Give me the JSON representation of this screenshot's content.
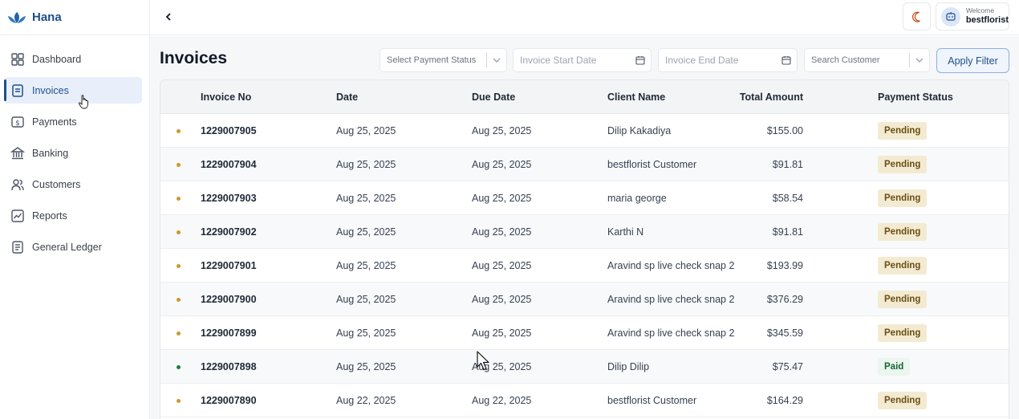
{
  "brand": {
    "name": "Hana",
    "color": "#1e4e8c"
  },
  "sidebar": {
    "items": [
      {
        "label": "Dashboard",
        "icon": "dashboard-grid-icon",
        "active": false
      },
      {
        "label": "Invoices",
        "icon": "invoice-icon",
        "active": true
      },
      {
        "label": "Payments",
        "icon": "dollar-icon",
        "active": false
      },
      {
        "label": "Banking",
        "icon": "bank-icon",
        "active": false
      },
      {
        "label": "Customers",
        "icon": "users-icon",
        "active": false
      },
      {
        "label": "Reports",
        "icon": "chart-line-icon",
        "active": false
      },
      {
        "label": "General Ledger",
        "icon": "ledger-icon",
        "active": false
      }
    ]
  },
  "topbar": {
    "welcome": "Welcome",
    "username": "bestflorist"
  },
  "page": {
    "title": "Invoices"
  },
  "filters": {
    "payment_status_placeholder": "Select Payment Status",
    "start_date_placeholder": "Invoice Start Date",
    "end_date_placeholder": "Invoice End Date",
    "customer_placeholder": "Search Customer",
    "apply_label": "Apply Filter"
  },
  "table": {
    "columns": [
      "Invoice No",
      "Date",
      "Due Date",
      "Client Name",
      "Total Amount",
      "Payment Status"
    ],
    "rows": [
      {
        "invoice_no": "1229007905",
        "date": "Aug 25, 2025",
        "due_date": "Aug 25, 2025",
        "client": "Dilip Kakadiya",
        "amount": "$155.00",
        "status": "Pending"
      },
      {
        "invoice_no": "1229007904",
        "date": "Aug 25, 2025",
        "due_date": "Aug 25, 2025",
        "client": "bestflorist Customer",
        "amount": "$91.81",
        "status": "Pending"
      },
      {
        "invoice_no": "1229007903",
        "date": "Aug 25, 2025",
        "due_date": "Aug 25, 2025",
        "client": "maria george",
        "amount": "$58.54",
        "status": "Pending"
      },
      {
        "invoice_no": "1229007902",
        "date": "Aug 25, 2025",
        "due_date": "Aug 25, 2025",
        "client": "Karthi N",
        "amount": "$91.81",
        "status": "Pending"
      },
      {
        "invoice_no": "1229007901",
        "date": "Aug 25, 2025",
        "due_date": "Aug 25, 2025",
        "client": "Aravind sp live check snap 2",
        "amount": "$193.99",
        "status": "Pending"
      },
      {
        "invoice_no": "1229007900",
        "date": "Aug 25, 2025",
        "due_date": "Aug 25, 2025",
        "client": "Aravind sp live check snap 2",
        "amount": "$376.29",
        "status": "Pending"
      },
      {
        "invoice_no": "1229007899",
        "date": "Aug 25, 2025",
        "due_date": "Aug 25, 2025",
        "client": "Aravind sp live check snap 2",
        "amount": "$345.59",
        "status": "Pending"
      },
      {
        "invoice_no": "1229007898",
        "date": "Aug 25, 2025",
        "due_date": "Aug 25, 2025",
        "client": "Dilip Dilip",
        "amount": "$75.47",
        "status": "Paid"
      },
      {
        "invoice_no": "1229007890",
        "date": "Aug 22, 2025",
        "due_date": "Aug 22, 2025",
        "client": "bestflorist Customer",
        "amount": "$164.29",
        "status": "Pending"
      }
    ]
  },
  "status_colors": {
    "Pending": {
      "dot": "#c99a2e",
      "bg": "#f3ead2",
      "fg": "#6b4f12"
    },
    "Paid": {
      "dot": "#15803d",
      "bg": "#eaf6ee",
      "fg": "#166534"
    }
  }
}
